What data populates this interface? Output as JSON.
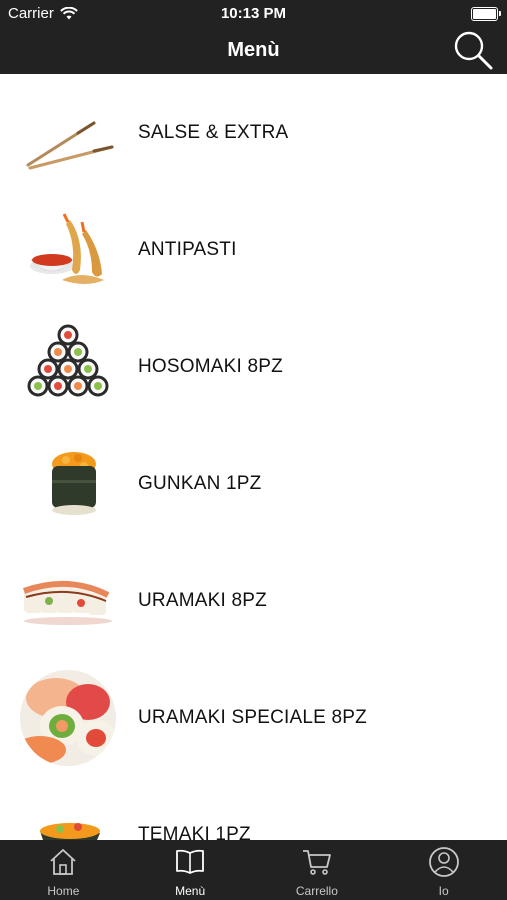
{
  "status_bar": {
    "carrier": "Carrier",
    "time": "10:13 PM"
  },
  "nav": {
    "title": "Menù"
  },
  "categories": [
    {
      "label": "SALSE & EXTRA",
      "icon": "chopsticks-image"
    },
    {
      "label": "ANTIPASTI",
      "icon": "fried-shrimp-image"
    },
    {
      "label": "HOSOMAKI 8PZ",
      "icon": "hosomaki-pyramid-image"
    },
    {
      "label": "GUNKAN 1PZ",
      "icon": "gunkan-image"
    },
    {
      "label": "URAMAKI 8PZ",
      "icon": "uramaki-image"
    },
    {
      "label": "URAMAKI SPECIALE 8PZ",
      "icon": "uramaki-speciale-image"
    },
    {
      "label": "TEMAKI 1PZ",
      "icon": "temaki-image"
    }
  ],
  "tabbar": {
    "active": "Menù",
    "tabs": [
      {
        "label": "Home",
        "icon": "home-icon"
      },
      {
        "label": "Menù",
        "icon": "book-icon"
      },
      {
        "label": "Carrello",
        "icon": "cart-icon"
      },
      {
        "label": "Io",
        "icon": "user-icon"
      }
    ]
  },
  "colors": {
    "bar_background": "#222222",
    "active_tab": "#ffffff",
    "inactive_tab": "#c8c8c8"
  }
}
